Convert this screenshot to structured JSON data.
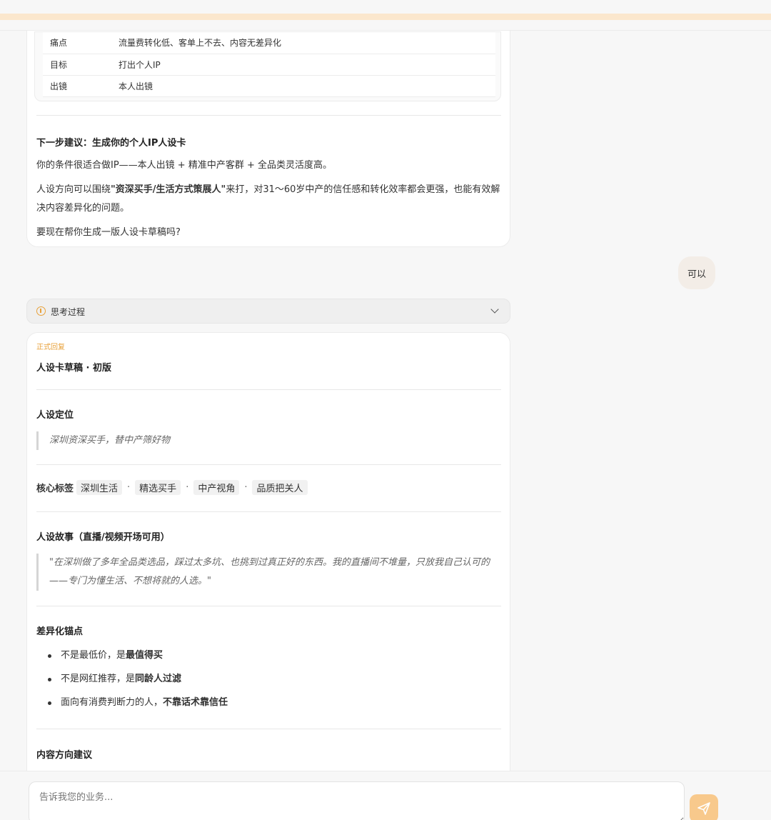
{
  "table": {
    "rows": [
      {
        "key": "痛点",
        "value": "流量费转化低、客单上不去、内容无差异化"
      },
      {
        "key": "目标",
        "value": "打出个人IP"
      },
      {
        "key": "出镜",
        "value": "本人出镜"
      }
    ]
  },
  "msg1": {
    "heading": "下一步建议：生成你的个人IP人设卡",
    "p1": "你的条件很适合做IP——本人出镜 + 精准中产客群 + 全品类灵活度高。",
    "p2_pre": "人设方向可以围绕",
    "p2_bold": "\"资深买手/生活方式策展人\"",
    "p2_post": "来打，对31～60岁中产的信任感和转化效率都会更强，也能有效解决内容差异化的问题。",
    "p3": "要现在帮你生成一版人设卡草稿吗?"
  },
  "user_msg": "可以",
  "thinking": {
    "label": "思考过程"
  },
  "msg2": {
    "reply_tag": "正式回复",
    "title": "人设卡草稿 · 初版",
    "s1_heading": "人设定位",
    "s1_quote": "深圳资深买手，替中产筛好物",
    "tags_label": "核心标签",
    "tags": [
      "深圳生活",
      "精选买手",
      "中产视角",
      "品质把关人"
    ],
    "tag_sep": "·",
    "s2_heading": "人设故事（直播/视频开场可用）",
    "s2_quote": "\"在深圳做了多年全品类选品，踩过太多坑、也挑到过真正好的东西。我的直播间不堆量，只放我自己认可的——专门为懂生活、不想将就的人选。\"",
    "s3_heading": "差异化锚点",
    "bullets": [
      {
        "pre": "不是最低价，是",
        "bold": "最值得买"
      },
      {
        "pre": "不是网红推荐，是",
        "bold": "同龄人过滤"
      },
      {
        "pre": "面向有消费判断力的人，",
        "bold": "不靠话术靠信任"
      }
    ],
    "s4_heading": "内容方向建议"
  },
  "input": {
    "placeholder": "告诉我您的业务..."
  },
  "colors": {
    "accent": "#e8a13a",
    "send_button": "#f8c98c",
    "user_bubble": "#f3ede7"
  },
  "icons": {
    "thinking": "info-circle-icon",
    "toggle": "chevron-down-icon",
    "send": "send-icon"
  }
}
